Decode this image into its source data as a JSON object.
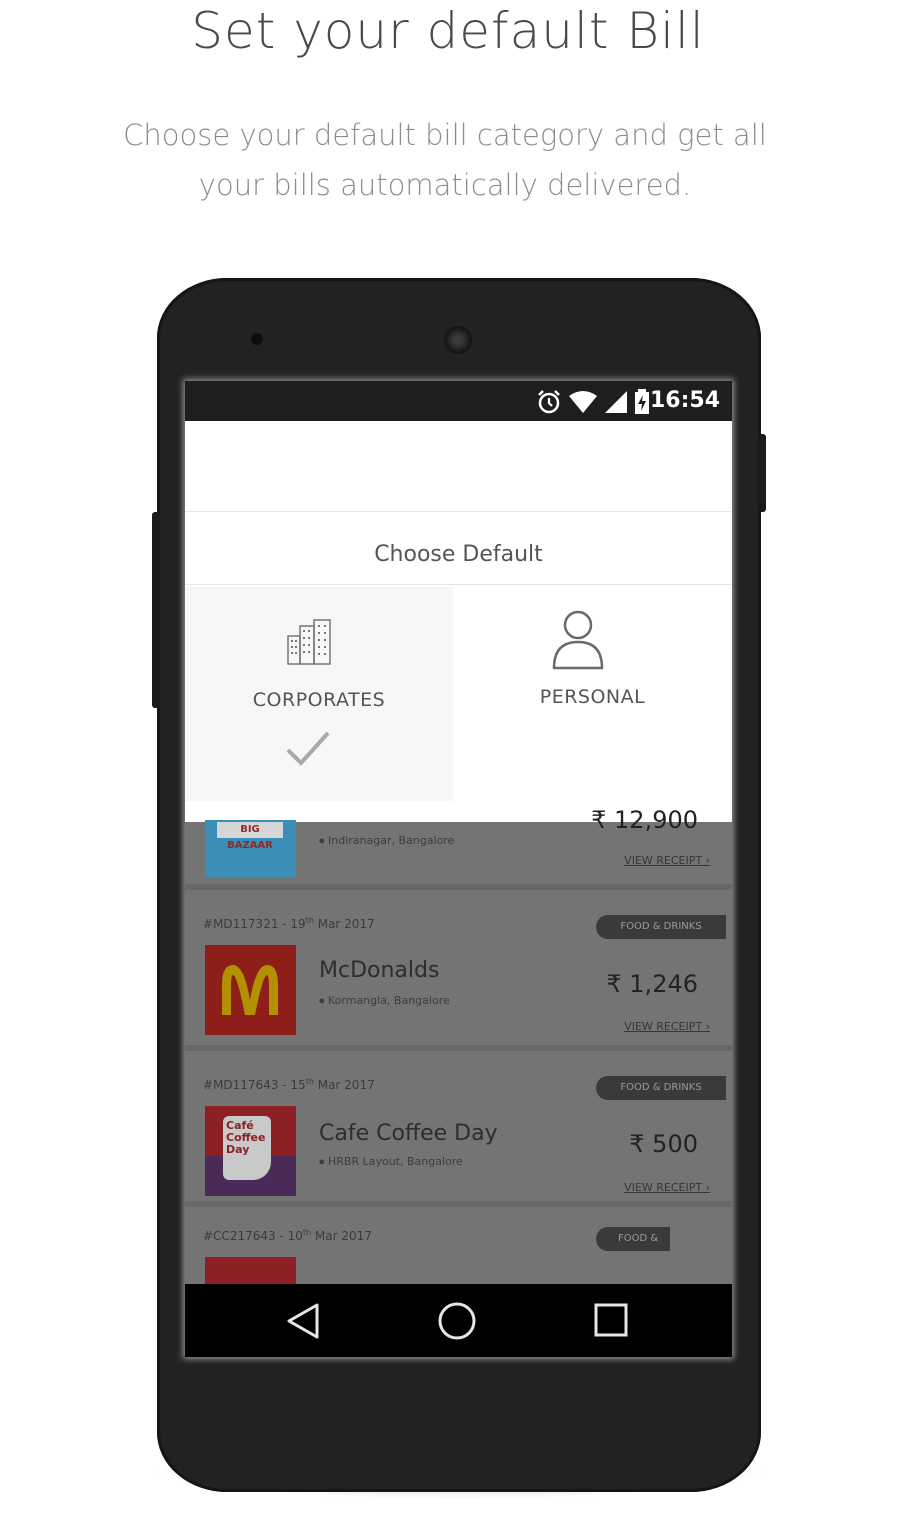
{
  "header": {
    "title": "Set your default Bill",
    "subtitle": "Choose your default bill category and get all your bills automatically delivered."
  },
  "status_bar": {
    "time": "16:54"
  },
  "dialog": {
    "title": "Choose Default",
    "options": [
      {
        "label": "CORPORATES",
        "selected": true,
        "icon": "buildings-icon"
      },
      {
        "label": "PERSONAL",
        "selected": false,
        "icon": "person-icon"
      }
    ]
  },
  "bills": [
    {
      "merchant_logo": "BIG BAZAAR",
      "location": "Indiranagar, Bangalore",
      "amount": "₹ 12,900",
      "receipt_label": "VIEW RECEIPT"
    },
    {
      "id_date_prefix": "#MD117321 - 19",
      "id_date_sup": "th",
      "id_date_suffix": " Mar 2017",
      "category": "FOOD & DRINKS",
      "merchant": "McDonalds",
      "location": "Kormangla, Bangalore",
      "amount": "₹ 1,246",
      "receipt_label": "VIEW RECEIPT"
    },
    {
      "id_date_prefix": "#MD117643 - 15",
      "id_date_sup": "th",
      "id_date_suffix": " Mar 2017",
      "category": "FOOD & DRINKS",
      "merchant": "Cafe Coffee Day",
      "merchant_logo": "Café Coffee Day",
      "location": "HRBR Layout, Bangalore",
      "amount": "₹ 500",
      "receipt_label": "VIEW RECEIPT"
    },
    {
      "id_date_prefix": "#CC217643 - 10",
      "id_date_sup": "th",
      "id_date_suffix": " Mar 2017",
      "category": "FOOD &"
    }
  ],
  "colors": {
    "screen_overlay": "#6f6f6f",
    "mcd_red": "#b3261e",
    "mcd_yellow": "#f2c300",
    "ccd_red": "#b3262b",
    "ccd_purple": "#5b2d6e",
    "bigbazaar_blue": "#2f8fbf"
  }
}
